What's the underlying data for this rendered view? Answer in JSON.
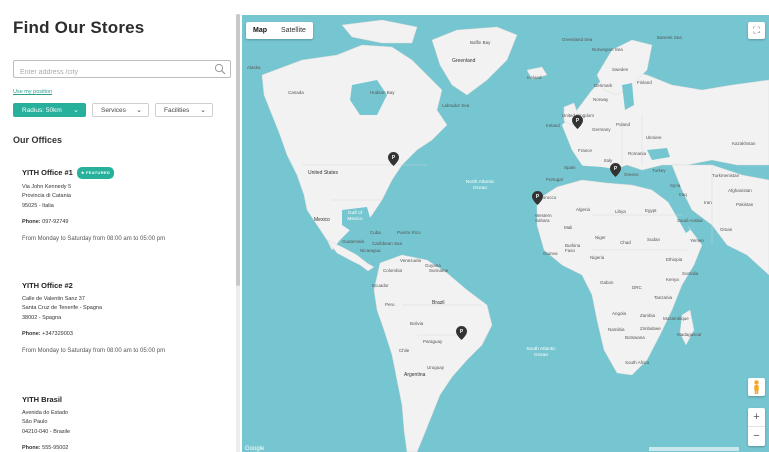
{
  "header": {
    "title": "Find Our Stores"
  },
  "search": {
    "placeholder": "Enter address /city",
    "use_position": "Use my position"
  },
  "filters": {
    "radius": "Radius: 50km",
    "services": "Services",
    "facilities": "Facilities"
  },
  "offices_title": "Our Offices",
  "offices": [
    {
      "name": "YITH Office #1",
      "badge": "FEATURED",
      "address1": "Via John Kennedy 5",
      "address2": "Provincia di Catania",
      "address3": "95025 - Italia",
      "phone_label": "Phone:",
      "phone": "097-92749",
      "hours": "From Monday to Saturday from 08:00 am to 05:00 pm"
    },
    {
      "name": "YITH Office #2",
      "address1": "Calle de Valentin Sanz 37",
      "address2": "Santa Cruz de Tenerife - Spagna",
      "address3": "38002 - Spagna",
      "phone_label": "Phone:",
      "phone": "+347329003",
      "hours": "From Monday to Saturday from 08:00 am to 05:00 pm"
    },
    {
      "name": "YITH Brasil",
      "address1": "Avenida do Estado",
      "address2": "São Paulo",
      "address3": "04210-040 - Brasile",
      "phone_label": "Phone:",
      "phone": "555-95002"
    }
  ],
  "map": {
    "toggle": {
      "map": "Map",
      "satellite": "Satellite"
    },
    "google": "Google",
    "colors": {
      "land": "#f2f2f2",
      "water": "#76c6d1",
      "accent": "#27b09c"
    },
    "labels": {
      "greenland": "Greenland",
      "canada": "Canada",
      "alaska": "Alaska",
      "united_states": "United States",
      "mexico": "Mexico",
      "cuba": "Cuba",
      "guatemala": "Guatemala",
      "nicaragua": "Nicaragua",
      "venezuela": "Venezuela",
      "colombia": "Colombia",
      "guyana": "Guyana",
      "suriname": "Suriname",
      "ecuador": "Ecuador",
      "peru": "Peru",
      "brazil": "Brazil",
      "bolivia": "Bolivia",
      "paraguay": "Paraguay",
      "chile": "Chile",
      "argentina": "Argentina",
      "uruguay": "Uruguay",
      "iceland": "Iceland",
      "sweden": "Sweden",
      "finland": "Finland",
      "norway": "Norway",
      "united_kingdom": "United Kingdom",
      "ireland": "Ireland",
      "germany": "Germany",
      "poland": "Poland",
      "france": "France",
      "ukraine": "Ukraine",
      "kazakhstan": "Kazakhstan",
      "spain": "Spain",
      "portugal": "Portugal",
      "italy": "Italy",
      "romania": "Romania",
      "greece": "Greece",
      "turkey": "Turkey",
      "turkmenistan": "Turkmenistan",
      "morocco": "Morocco",
      "algeria": "Algeria",
      "libya": "Libya",
      "egypt": "Egypt",
      "syria": "Syria",
      "iraq": "Iraq",
      "iran": "Iran",
      "afghanistan": "Afghanistan",
      "pakistan": "Pakistan",
      "saudi_arabia": "Saudi Arabia",
      "oman": "Oman",
      "yemen": "Yemen",
      "western_sahara": "Western Sahara",
      "mali": "Mali",
      "niger": "Niger",
      "chad": "Chad",
      "sudan": "Sudan",
      "ethiopia": "Ethiopia",
      "burkina_faso": "Burkina Faso",
      "guinea": "Guinea",
      "nigeria": "Nigeria",
      "somalia": "Somalia",
      "kenya": "Kenya",
      "gabon": "Gabon",
      "drc": "DRC",
      "tanzania": "Tanzania",
      "angola": "Angola",
      "zambia": "Zambia",
      "namibia": "Namibia",
      "zimbabwe": "Zimbabwe",
      "botswana": "Botswana",
      "mozambique": "Mozambique",
      "madagascar": "Madagascar",
      "south_africa": "South Africa",
      "north_atlantic_ocean": "North Atlantic Ocean",
      "south_atlantic_ocean": "South Atlantic Ocean",
      "gulf_of_mexico": "Gulf of Mexico",
      "caribbean_sea": "Caribbean Sea",
      "hudson_bay": "Hudson Bay",
      "labrador_sea": "Labrador Sea",
      "puerto_rico": "Puerto Rico",
      "denmark": "Denmark",
      "baffin_bay": "Baffin Bay",
      "norwegian_sea": "Norwegian Sea",
      "barents_sea": "Barents Sea",
      "greenland_sea": "Greenland Sea"
    }
  }
}
